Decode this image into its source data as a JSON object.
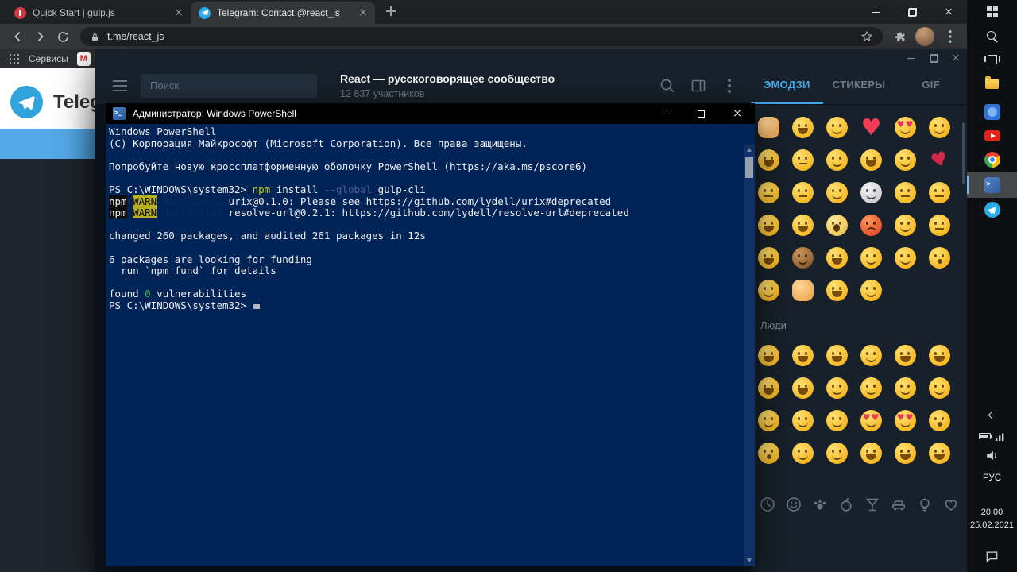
{
  "browser": {
    "tabs": [
      {
        "title": "Quick Start | gulp.js",
        "favicon": "gulp",
        "active": false
      },
      {
        "title": "Telegram: Contact @react_js",
        "favicon": "telegram",
        "active": true
      }
    ],
    "url": "t.me/react_js",
    "bookmarks_label": "Сервисы"
  },
  "page": {
    "site_title": "Telegram"
  },
  "telegram": {
    "search_placeholder": "Поиск",
    "chat": {
      "title": "React — русскоговорящее сообщество",
      "subtitle": "12 837 участников"
    },
    "panel": {
      "tabs": [
        {
          "label": "ЭМОДЗИ",
          "active": true
        },
        {
          "label": "СТИКЕРЫ",
          "active": false
        },
        {
          "label": "GIF",
          "active": false
        }
      ],
      "sections": [
        {
          "label": "",
          "emojis": [
            "thumbs-up",
            "face-with-tears-of-joy",
            "smiling-face-with-smiling-eyes",
            "red-heart",
            "smiling-face-with-heart-eyes",
            "beaming-face-with-smiling-eyes",
            "grinning-face-with-big-eyes",
            "smirking-face",
            "winking-face",
            "grinning-face-with-sweat",
            "relieved-face",
            "kiss-mark",
            "flushed-face",
            "grimacing-face",
            "upside-down-face",
            "hamster-face",
            "neutral-face",
            "expressionless-face",
            "grinning-squinting-face",
            "squinting-face-with-tongue",
            "face-screaming-in-fear",
            "enraged-face",
            "kissing-face-with-closed-eyes",
            "pensive-face",
            "zany-face",
            "speak-no-evil-monkey",
            "grinning-face-with-sweat",
            "smiling-face-with-halo",
            "smiling-face",
            "face-blowing-a-kiss",
            "kissing-face-with-smiling-eyes",
            "crossed-fingers",
            "grinning-face",
            "slightly-smiling-face"
          ]
        },
        {
          "label": "Люди",
          "emojis": [
            "grinning-face",
            "grinning-face-with-big-eyes",
            "grinning-face-with-smiling-eyes",
            "beaming-face-with-smiling-eyes",
            "grinning-squinting-face",
            "grinning-face-with-sweat",
            "face-with-tears-of-joy",
            "rolling-on-the-floor-laughing",
            "smiling-face",
            "smiling-face-with-smiling-eyes",
            "smiling-face-with-halo",
            "slightly-smiling-face",
            "upside-down-face",
            "winking-face",
            "relieved-face",
            "smiling-face-with-heart-eyes",
            "smiling-face-with-hearts",
            "face-blowing-a-kiss",
            "kissing-face",
            "kissing-face-with-smiling-eyes",
            "kissing-face-with-closed-eyes",
            "face-savoring-food",
            "face-with-tongue",
            "squinting-face-with-tongue"
          ]
        }
      ],
      "categories": [
        "recent",
        "smileys-people",
        "animals-nature",
        "food-drink",
        "activity",
        "travel-places",
        "objects",
        "symbols"
      ]
    }
  },
  "powershell": {
    "title": "Администратор: Windows PowerShell",
    "lines": [
      [
        {
          "t": "Windows PowerShell",
          "c": "w"
        }
      ],
      [
        {
          "t": "(C) Корпорация Майкрософт (Microsoft Corporation). Все права защищены.",
          "c": "w"
        }
      ],
      [],
      [
        {
          "t": "Попробуйте новую кроссплатформенную оболочку PowerShell (https://aka.ms/pscore6)",
          "c": "w"
        }
      ],
      [],
      [
        {
          "t": "PS C:\\WINDOWS\\system32> ",
          "c": "w"
        },
        {
          "t": "npm",
          "c": "y"
        },
        {
          "t": " install ",
          "c": "w"
        },
        {
          "t": "--global",
          "c": "dim"
        },
        {
          "t": " gulp-cli",
          "c": "w"
        }
      ],
      [
        {
          "t": "npm",
          "c": "npm"
        },
        {
          "t": " ",
          "c": "w"
        },
        {
          "t": "WARN",
          "c": "warn"
        },
        {
          "t": " ",
          "c": "w"
        },
        {
          "t": "deprecated",
          "c": "hid"
        },
        {
          "t": " urix@0.1.0: Please see https://github.com/lydell/urix#deprecated",
          "c": "w"
        }
      ],
      [
        {
          "t": "npm",
          "c": "npm"
        },
        {
          "t": " ",
          "c": "w"
        },
        {
          "t": "WARN",
          "c": "warn"
        },
        {
          "t": " ",
          "c": "w"
        },
        {
          "t": "deprecated",
          "c": "hid"
        },
        {
          "t": " resolve-url@0.2.1: https://github.com/lydell/resolve-url#deprecated",
          "c": "w"
        }
      ],
      [],
      [
        {
          "t": "changed 260 packages, and audited 261 packages in 12s",
          "c": "w"
        }
      ],
      [],
      [
        {
          "t": "6 packages are looking for funding",
          "c": "w"
        }
      ],
      [
        {
          "t": "  run `npm fund` for details",
          "c": "w"
        }
      ],
      [],
      [
        {
          "t": "found ",
          "c": "w"
        },
        {
          "t": "0",
          "c": "g"
        },
        {
          "t": " vulnerabilities",
          "c": "w"
        }
      ],
      [
        {
          "t": "PS C:\\WINDOWS\\system32> ",
          "c": "w"
        },
        {
          "t": "",
          "c": "cursor"
        }
      ]
    ]
  },
  "taskbar": {
    "apps": [
      {
        "name": "start",
        "active": false
      },
      {
        "name": "search",
        "active": false
      },
      {
        "name": "task-view",
        "active": false
      },
      {
        "name": "file-explorer",
        "active": false
      },
      {
        "name": "blue-app",
        "active": false
      },
      {
        "name": "youtube",
        "active": false
      },
      {
        "name": "chrome",
        "active": false
      },
      {
        "name": "powershell",
        "active": true
      },
      {
        "name": "telegram",
        "active": false
      }
    ],
    "tray": {
      "lang": "РУС",
      "time": "20:00",
      "date": "25.02.2021"
    }
  },
  "colors": {
    "accent_blue": "#47a7e8",
    "telegram_blue": "#2aabee",
    "powershell_bg": "#012456",
    "warn_yellow": "#b9b023",
    "ok_green": "#2fbe3a"
  }
}
